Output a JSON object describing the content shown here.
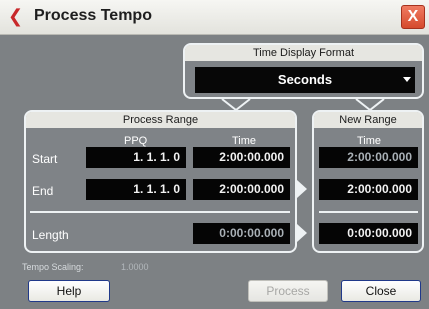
{
  "window": {
    "title": "Process Tempo",
    "close_glyph": "X"
  },
  "time_display_format": {
    "header": "Time Display Format",
    "value": "Seconds"
  },
  "process_range": {
    "header": "Process Range",
    "col_ppq": "PPQ",
    "col_time": "Time",
    "start_label": "Start",
    "end_label": "End",
    "length_label": "Length",
    "start_ppq": "1.  1.  1.    0",
    "start_time": "2:00:00.000",
    "end_ppq": "1.  1.  1.    0",
    "end_time": "2:00:00.000",
    "length_time": "0:00:00.000"
  },
  "new_range": {
    "header": "New Range",
    "col_time": "Time",
    "start_time": "2:00:00.000",
    "end_time": "2:00:00.000",
    "length_time": "0:00:00.000"
  },
  "tempo_scaling": {
    "label": "Tempo Scaling:",
    "value": "1.0000"
  },
  "buttons": {
    "help": "Help",
    "process": "Process",
    "close": "Close"
  },
  "colors": {
    "panel_border": "#eef2f4",
    "lcd_bg": "#050505",
    "title_icon": "#c8282a",
    "close_button": "#d54b2d"
  }
}
